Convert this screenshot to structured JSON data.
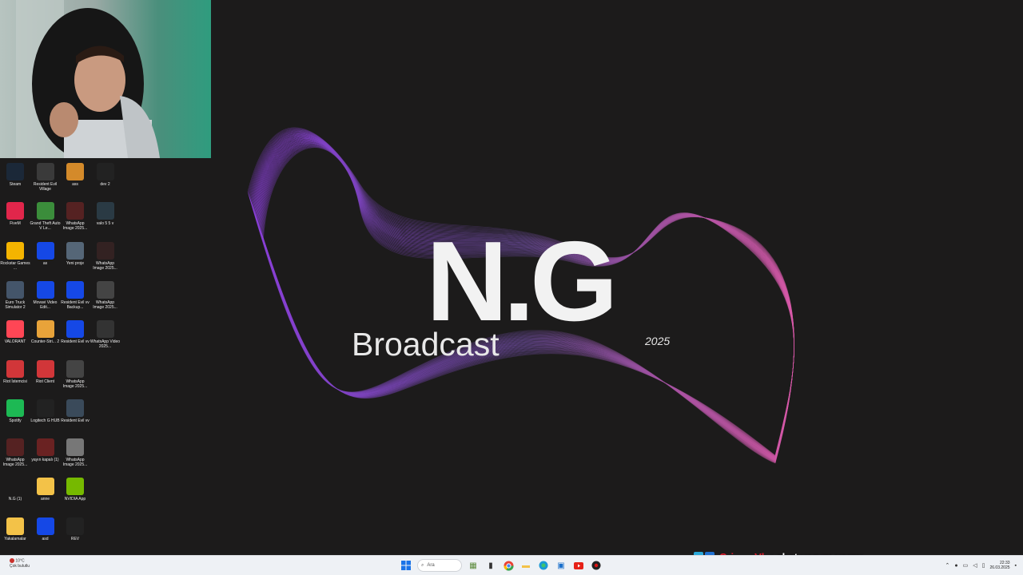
{
  "overlay": {
    "brand": "N.G",
    "subtitle": "Broadcast",
    "year": "2025"
  },
  "desktop_icons": [
    {
      "label": "Steam",
      "icon": "steam-icon",
      "color": "#1b2838"
    },
    {
      "label": "Resident Evil Village",
      "icon": "game-icon",
      "color": "#3a3a3a"
    },
    {
      "label": "ass",
      "icon": "image-icon",
      "color": "#d48a2a"
    },
    {
      "label": "dev 2",
      "icon": "image-icon",
      "color": "#222222"
    },
    {
      "label": "FiveM",
      "icon": "fivem-icon",
      "color": "#e1264b"
    },
    {
      "label": "Grand Theft Auto V Le...",
      "icon": "gta-icon",
      "color": "#3b8d3b"
    },
    {
      "label": "WhatsApp Image 2025...",
      "icon": "image-icon",
      "color": "#552222"
    },
    {
      "label": "valo 5 5 v",
      "icon": "image-icon",
      "color": "#2a3a44"
    },
    {
      "label": "Rockstar Games ...",
      "icon": "rockstar-icon",
      "color": "#f4b400"
    },
    {
      "label": "as",
      "icon": "file-icon",
      "color": "#1548e6"
    },
    {
      "label": "Yeni proje",
      "icon": "image-icon",
      "color": "#556677"
    },
    {
      "label": "WhatsApp Image 2025...",
      "icon": "image-icon",
      "color": "#332222"
    },
    {
      "label": "Euro Truck Simulator 2",
      "icon": "truck-icon",
      "color": "#44556a"
    },
    {
      "label": "Movavi Video Edit...",
      "icon": "file-icon",
      "color": "#1548e6"
    },
    {
      "label": "Resident Evil vv Backup...",
      "icon": "file-icon",
      "color": "#1548e6"
    },
    {
      "label": "WhatsApp Image 2025...",
      "icon": "image-icon",
      "color": "#444444"
    },
    {
      "label": "VALORANT",
      "icon": "valorant-icon",
      "color": "#ff4655"
    },
    {
      "label": "Counter-Stri... 2",
      "icon": "cs2-icon",
      "color": "#e8a33a"
    },
    {
      "label": "Resident Evil vv",
      "icon": "file-icon",
      "color": "#1548e6"
    },
    {
      "label": "WhatsApp Video 2025...",
      "icon": "image-icon",
      "color": "#333333"
    },
    {
      "label": "Riot İstemcisi",
      "icon": "riot-icon",
      "color": "#d13639"
    },
    {
      "label": "Riot Client",
      "icon": "riot-icon",
      "color": "#d13639"
    },
    {
      "label": "WhatsApp Image 2025...",
      "icon": "image-icon",
      "color": "#444444"
    },
    {
      "label": "",
      "icon": "empty",
      "color": "transparent"
    },
    {
      "label": "Spotify",
      "icon": "spotify-icon",
      "color": "#1db954"
    },
    {
      "label": "Logitech G HUB",
      "icon": "logitech-icon",
      "color": "#222222"
    },
    {
      "label": "Resident Evil vv",
      "icon": "image-icon",
      "color": "#3a4a5a"
    },
    {
      "label": "",
      "icon": "empty",
      "color": "transparent"
    },
    {
      "label": "WhatsApp Image 2025...",
      "icon": "image-icon",
      "color": "#552222"
    },
    {
      "label": "yayın kapalı (1)",
      "icon": "image-icon",
      "color": "#6a2222"
    },
    {
      "label": "WhatsApp Image 2025...",
      "icon": "image-icon",
      "color": "#777777"
    },
    {
      "label": "",
      "icon": "empty",
      "color": "transparent"
    },
    {
      "label": "N.G (1)",
      "icon": "image-icon",
      "color": "#1c1b1b"
    },
    {
      "label": "anne",
      "icon": "folder-icon",
      "color": "#f3c248"
    },
    {
      "label": "NVIDIA App",
      "icon": "nvidia-icon",
      "color": "#76b900"
    },
    {
      "label": "",
      "icon": "empty",
      "color": "transparent"
    },
    {
      "label": "Yakalamalar",
      "icon": "folder-icon",
      "color": "#f3c248"
    },
    {
      "label": "asd",
      "icon": "file-icon",
      "color": "#1548e6"
    },
    {
      "label": "REV",
      "icon": "image-icon",
      "color": "#222222"
    }
  ],
  "chat": {
    "user": "CrimesVlr",
    "message": ": chat yorum varmı"
  },
  "taskbar": {
    "weather_temp": "10°C",
    "weather_desc": "Çok bulutlu",
    "search_placeholder": "Ara",
    "time": "22:33",
    "date": "26.03.2025"
  }
}
